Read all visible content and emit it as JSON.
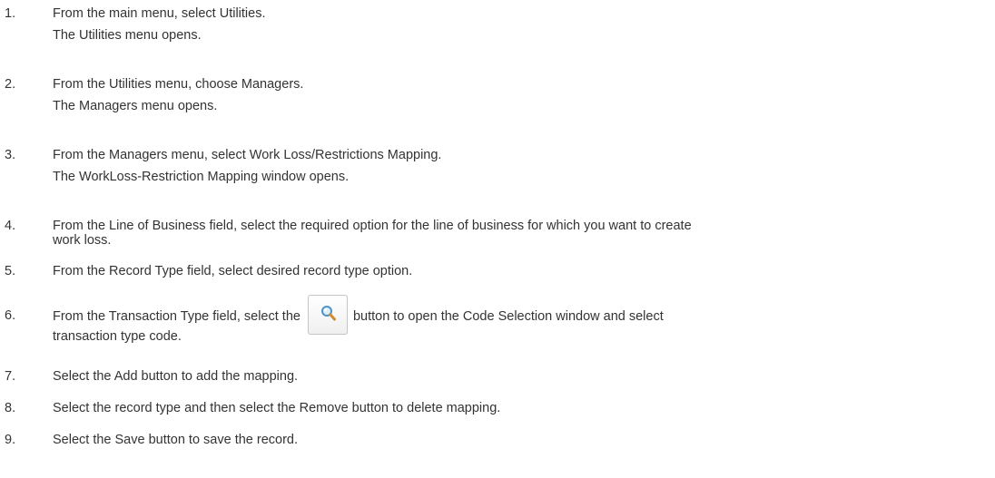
{
  "steps": [
    {
      "num": "1.",
      "text": "From the main menu, select Utilities.",
      "result": "The Utilities menu opens."
    },
    {
      "num": "2.",
      "text": "From the Utilities menu, choose Managers.",
      "result": "The Managers menu opens."
    },
    {
      "num": "3.",
      "text": "From the Managers menu, select Work Loss/Restrictions Mapping.",
      "result": "The WorkLoss-Restriction Mapping window opens."
    },
    {
      "num": "4.",
      "text_line1": "From the Line of Business field, select the required option for the line of business for which you want to create",
      "text_line2": "work loss."
    },
    {
      "num": "5.",
      "text": "From the Record Type field, select desired record type option."
    },
    {
      "num": "6.",
      "text_before": "From the Transaction Type field, select the",
      "text_after": "button to open the Code Selection window and select",
      "text_line2": "transaction type code.",
      "icon": "search-icon"
    },
    {
      "num": "7.",
      "text": "Select the Add button to add the mapping."
    },
    {
      "num": "8.",
      "text": "Select the record type and then select the Remove button to delete mapping."
    },
    {
      "num": "9.",
      "text": "Select the Save button to save the record."
    }
  ]
}
